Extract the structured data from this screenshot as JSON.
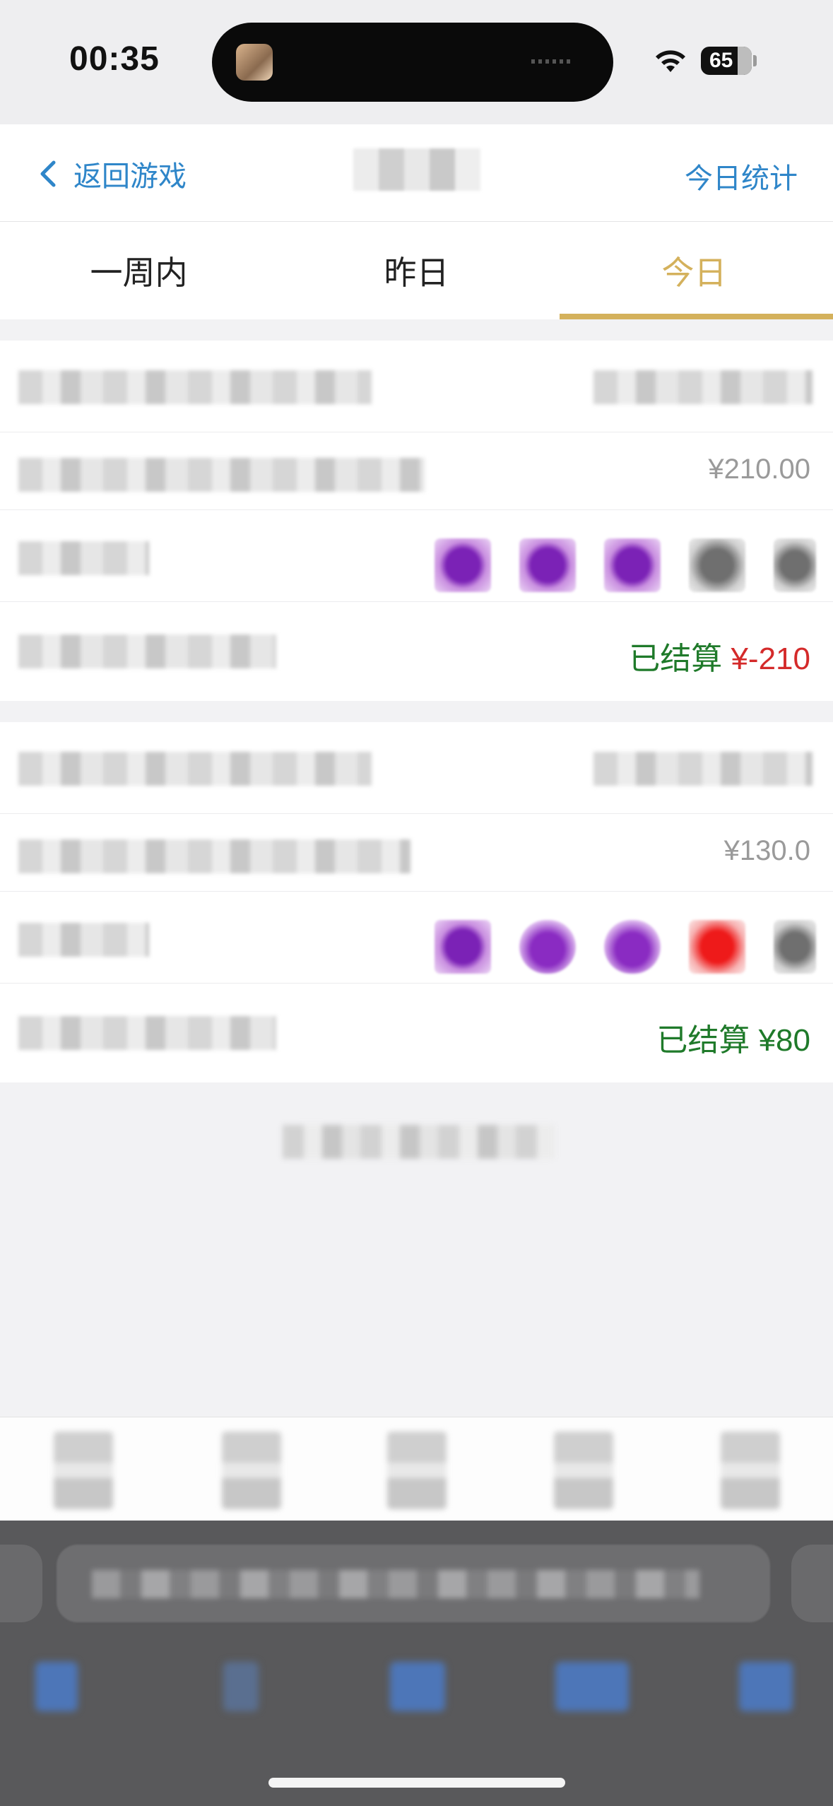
{
  "status_bar": {
    "time": "00:35",
    "battery": "65"
  },
  "nav": {
    "back_label": "返回游戏",
    "right_link": "今日统计"
  },
  "tabs": [
    {
      "label": "一周内",
      "active": false
    },
    {
      "label": "昨日",
      "active": false
    },
    {
      "label": "今日",
      "active": true
    }
  ],
  "records": [
    {
      "amount": "¥210.00",
      "settle_label": "已结算",
      "settle_value": "¥-210"
    },
    {
      "amount": "¥130.0",
      "settle_label": "已结算",
      "settle_value": "¥80"
    }
  ],
  "colors": {
    "accent_link": "#2f86c9",
    "tab_active": "#d4b15c",
    "settled_green": "#1f7a2a",
    "loss_red": "#d42a2a"
  }
}
